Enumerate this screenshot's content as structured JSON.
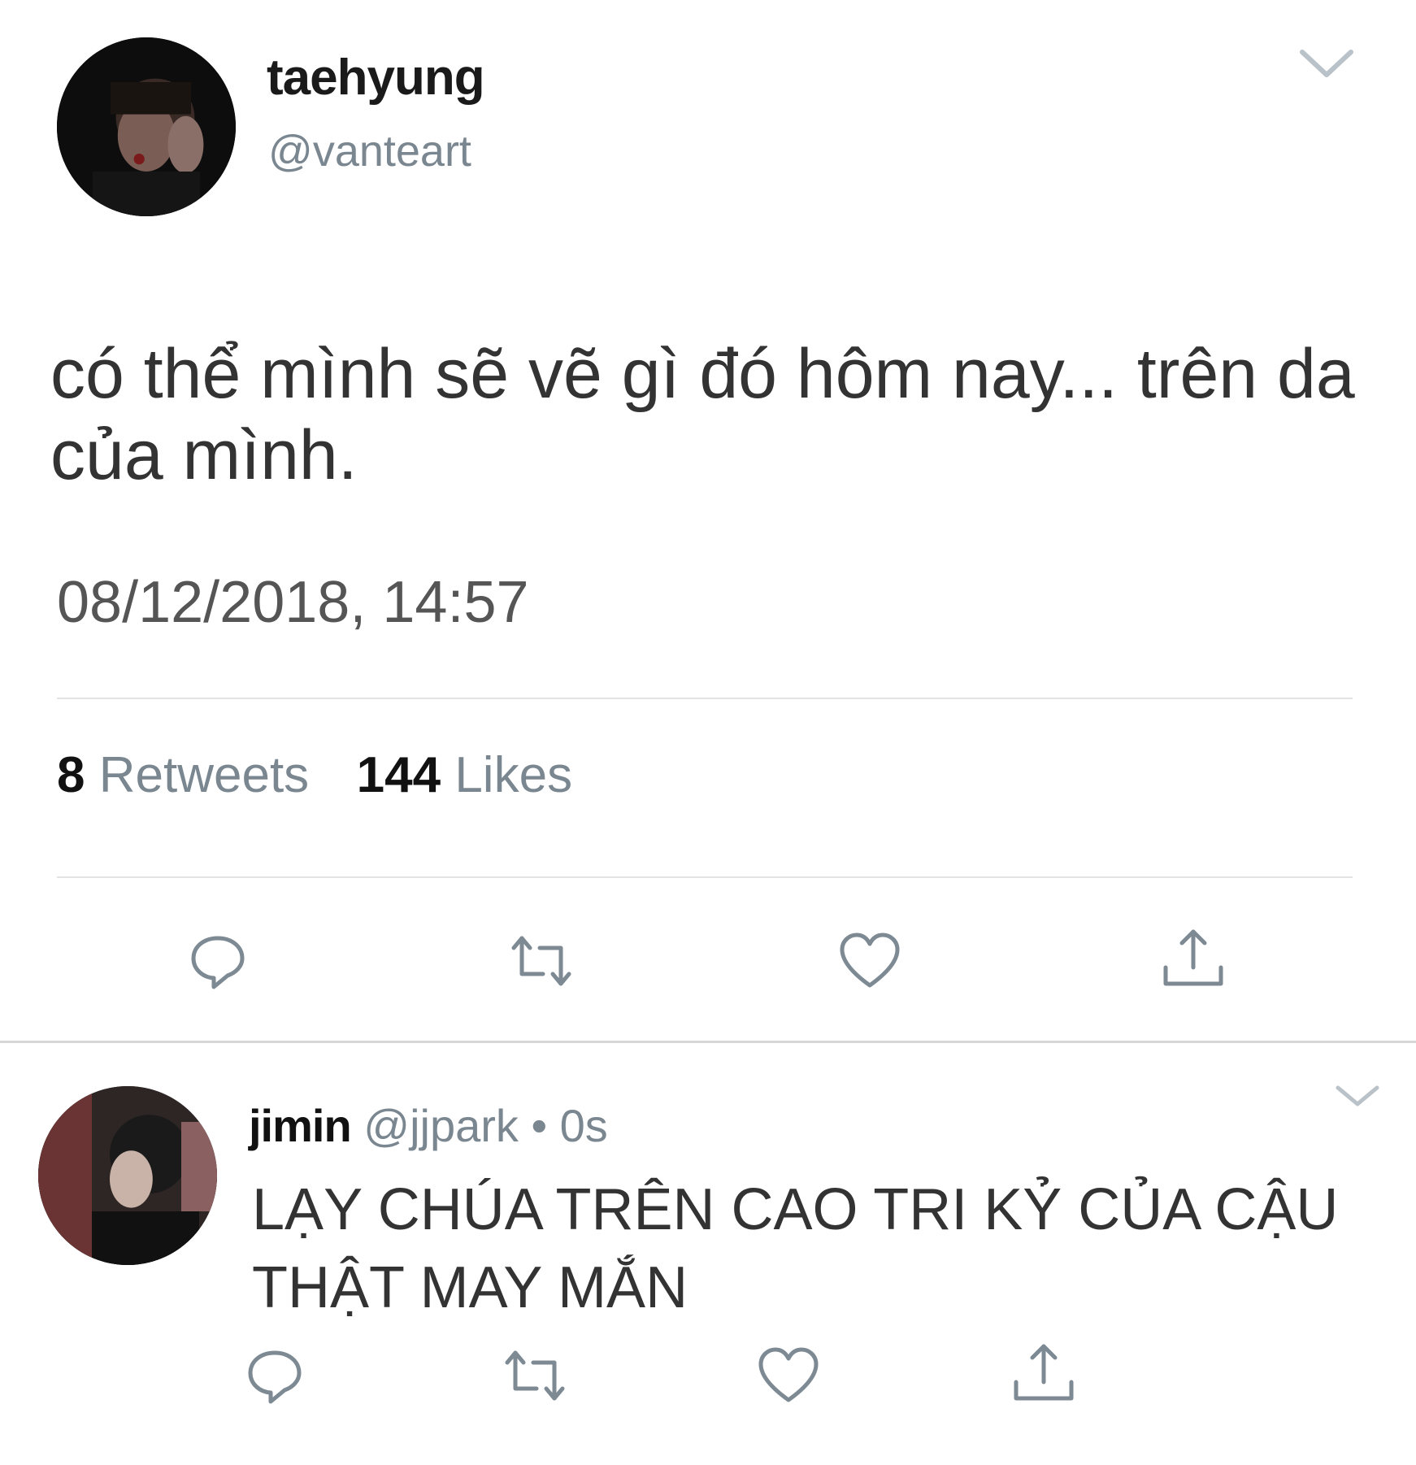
{
  "main_tweet": {
    "name": "taehyung",
    "handle": "@vanteart",
    "text": "có thể mình sẽ vẽ gì đó hôm nay... trên da của mình.",
    "timestamp": "08/12/2018, 14:57",
    "retweets_count": "8",
    "retweets_label": "Retweets",
    "likes_count": "144",
    "likes_label": "Likes",
    "actions": [
      "reply-icon",
      "retweet-icon",
      "like-icon",
      "share-icon"
    ]
  },
  "reply_tweet": {
    "name": "jimin",
    "handle": "@jjpark",
    "separator": "•",
    "time": "0s",
    "text": "LẠY CHÚA TRÊN CAO TRI KỶ CỦA CẬU THẬT MAY MẮN",
    "actions": [
      "reply-icon",
      "retweet-icon",
      "like-icon",
      "share-icon"
    ]
  },
  "colors": {
    "secondary_text": "#7a8790",
    "icon_gray": "#7d8a93",
    "divider": "#e3e3e3"
  }
}
